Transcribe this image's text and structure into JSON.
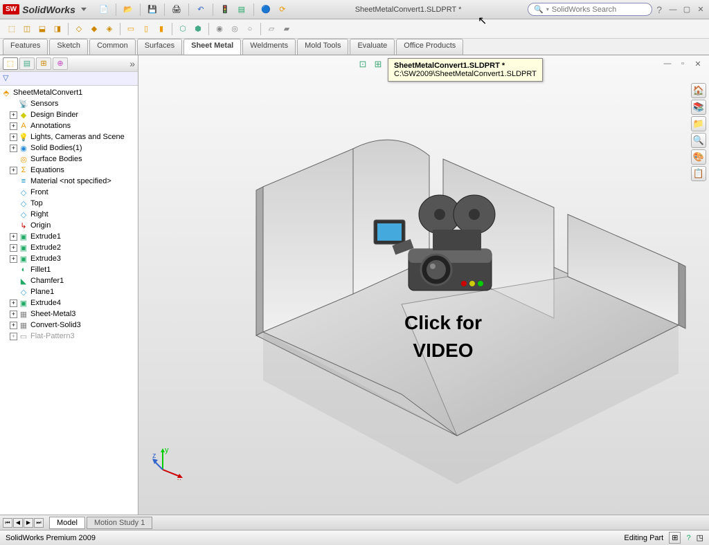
{
  "app": {
    "logo": "SW",
    "name": "SolidWorks"
  },
  "doc_title": "SheetMetalConvert1.SLDPRT *",
  "search": {
    "placeholder": "SolidWorks Search"
  },
  "command_tabs": [
    "Features",
    "Sketch",
    "Common",
    "Surfaces",
    "Sheet Metal",
    "Weldments",
    "Mold Tools",
    "Evaluate",
    "Office Products"
  ],
  "active_tab_index": 4,
  "tooltip": {
    "title": "SheetMetalConvert1.SLDPRT *",
    "path": "C:\\SW2009\\SheetMetalConvert1.SLDPRT"
  },
  "tree_root": "SheetMetalConvert1",
  "tree": [
    {
      "icon": "📡",
      "label": "Sensors",
      "exp": false
    },
    {
      "icon": "◆",
      "label": "Design Binder",
      "exp": true,
      "color": "#cc0"
    },
    {
      "icon": "A",
      "label": "Annotations",
      "exp": true,
      "color": "#e90"
    },
    {
      "icon": "💡",
      "label": "Lights, Cameras and Scene",
      "exp": true
    },
    {
      "icon": "◉",
      "label": "Solid Bodies(1)",
      "exp": true,
      "color": "#28d"
    },
    {
      "icon": "◎",
      "label": "Surface Bodies",
      "exp": false,
      "color": "#e90"
    },
    {
      "icon": "Σ",
      "label": "Equations",
      "exp": true,
      "color": "#e90"
    },
    {
      "icon": "≡",
      "label": "Material <not specified>",
      "exp": false,
      "color": "#08c"
    },
    {
      "icon": "◇",
      "label": "Front",
      "exp": false,
      "color": "#4ae"
    },
    {
      "icon": "◇",
      "label": "Top",
      "exp": false,
      "color": "#4ae"
    },
    {
      "icon": "◇",
      "label": "Right",
      "exp": false,
      "color": "#4ae"
    },
    {
      "icon": "↳",
      "label": "Origin",
      "exp": false,
      "color": "#c00"
    },
    {
      "icon": "▣",
      "label": "Extrude1",
      "exp": true,
      "color": "#2a6"
    },
    {
      "icon": "▣",
      "label": "Extrude2",
      "exp": true,
      "color": "#2a6"
    },
    {
      "icon": "▣",
      "label": "Extrude3",
      "exp": true,
      "color": "#2a6"
    },
    {
      "icon": "◐",
      "label": "Fillet1",
      "exp": false,
      "color": "#2a6"
    },
    {
      "icon": "◣",
      "label": "Chamfer1",
      "exp": false,
      "color": "#2a6"
    },
    {
      "icon": "◇",
      "label": "Plane1",
      "exp": false,
      "color": "#4ae"
    },
    {
      "icon": "▣",
      "label": "Extrude4",
      "exp": true,
      "color": "#2a6"
    },
    {
      "icon": "▦",
      "label": "Sheet-Metal3",
      "exp": true,
      "color": "#888"
    },
    {
      "icon": "▦",
      "label": "Convert-Solid3",
      "exp": true,
      "color": "#888"
    },
    {
      "icon": "▭",
      "label": "Flat-Pattern3",
      "exp": true,
      "grey": true
    }
  ],
  "bottom_tabs": {
    "active": "Model",
    "other": "Motion Study 1"
  },
  "status": {
    "left": "SolidWorks Premium 2009",
    "right": "Editing Part"
  },
  "overlay": {
    "line1": "Click for",
    "line2": "VIDEO"
  },
  "triad": {
    "x": "x",
    "y": "y",
    "z": "z"
  },
  "filter_icon": "▽"
}
